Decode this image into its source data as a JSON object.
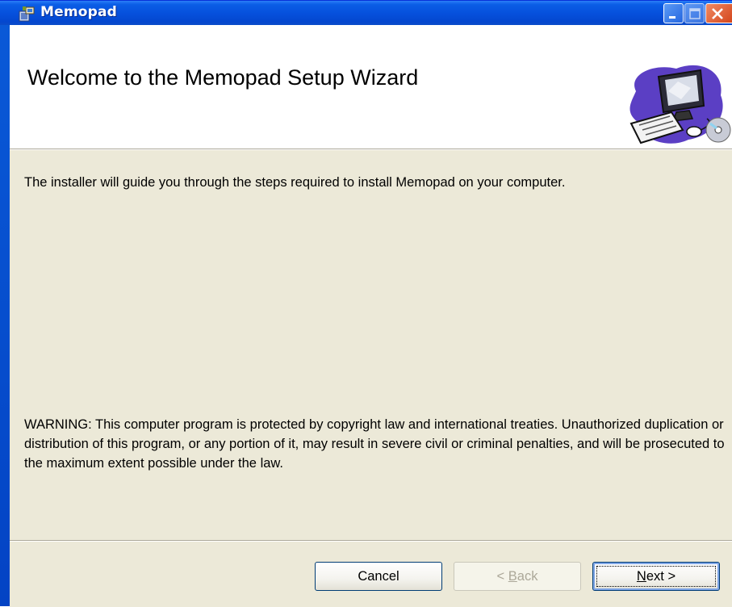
{
  "window": {
    "title": "Memopad",
    "controls": {
      "minimize_icon": "minimize-icon",
      "maximize_icon": "maximize-icon",
      "close_icon": "close-icon"
    }
  },
  "banner": {
    "title": "Welcome to the Memopad Setup Wizard",
    "art_icon": "computer-setup-clipart"
  },
  "body": {
    "intro": "The installer will guide you through the steps required to install Memopad on your computer.",
    "warning": "WARNING: This computer program is protected by copyright law and international treaties. Unauthorized duplication or distribution of this program, or any portion of it, may result in severe civil or criminal penalties, and will be prosecuted to the maximum extent possible under the law."
  },
  "buttons": {
    "cancel": "Cancel",
    "back_mnemonic": "B",
    "back_prefix": "< ",
    "back_rest": "ack",
    "next_mnemonic": "N",
    "next_rest": "ext >",
    "back_enabled": false
  },
  "colors": {
    "titlebar": "#0651dd",
    "client": "#ece9d8",
    "banner": "#ffffff",
    "close_button": "#d4461c"
  }
}
